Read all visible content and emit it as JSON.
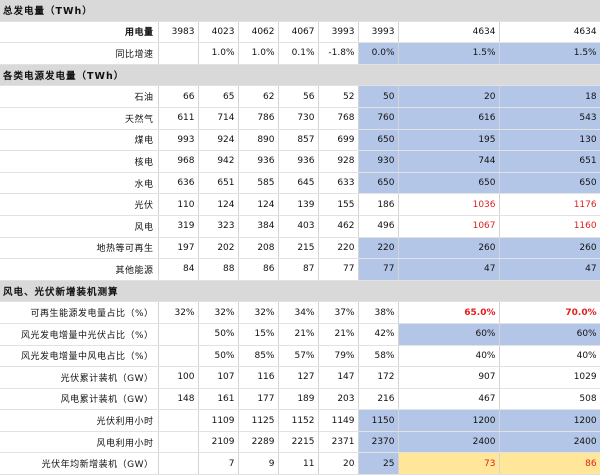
{
  "colors": {
    "blue": "#b4c6e7",
    "yellow": "#ffe699",
    "red": "#e02020",
    "section": "#d9d9d9"
  },
  "rows": [
    {
      "type": "section",
      "label": "总发电量（TWh）"
    },
    {
      "label": "用电量",
      "bold": true,
      "values": [
        "3983",
        "4023",
        "4062",
        "4067",
        "3993",
        "3993",
        "4634",
        "4634"
      ],
      "styles": [
        "",
        "",
        "",
        "",
        "",
        "",
        "",
        ""
      ]
    },
    {
      "label": "同比增速",
      "values": [
        "",
        "1.0%",
        "1.0%",
        "0.1%",
        "-1.8%",
        "0.0%",
        "1.5%",
        "1.5%"
      ],
      "styles": [
        "",
        "",
        "",
        "",
        "",
        "blue",
        "blue",
        "blue"
      ]
    },
    {
      "type": "section",
      "label": "各类电源发电量（TWh）"
    },
    {
      "label": "石油",
      "values": [
        "66",
        "65",
        "62",
        "56",
        "52",
        "50",
        "20",
        "18"
      ],
      "styles": [
        "",
        "",
        "",
        "",
        "",
        "blue",
        "blue",
        "blue"
      ]
    },
    {
      "label": "天然气",
      "values": [
        "611",
        "714",
        "786",
        "730",
        "768",
        "760",
        "616",
        "543"
      ],
      "styles": [
        "",
        "",
        "",
        "",
        "",
        "blue",
        "blue",
        "blue"
      ]
    },
    {
      "label": "煤电",
      "values": [
        "993",
        "924",
        "890",
        "857",
        "699",
        "650",
        "195",
        "130"
      ],
      "styles": [
        "",
        "",
        "",
        "",
        "",
        "blue",
        "blue",
        "blue"
      ]
    },
    {
      "label": "核电",
      "values": [
        "968",
        "942",
        "936",
        "936",
        "928",
        "930",
        "744",
        "651"
      ],
      "styles": [
        "",
        "",
        "",
        "",
        "",
        "blue",
        "blue",
        "blue"
      ]
    },
    {
      "label": "水电",
      "values": [
        "636",
        "651",
        "585",
        "645",
        "633",
        "650",
        "650",
        "650"
      ],
      "styles": [
        "",
        "",
        "",
        "",
        "",
        "blue",
        "blue",
        "blue"
      ]
    },
    {
      "label": "光伏",
      "values": [
        "110",
        "124",
        "124",
        "139",
        "155",
        "186",
        "1036",
        "1176"
      ],
      "styles": [
        "",
        "",
        "",
        "",
        "",
        "",
        "red",
        "red"
      ]
    },
    {
      "label": "风电",
      "values": [
        "319",
        "323",
        "384",
        "403",
        "462",
        "496",
        "1067",
        "1160"
      ],
      "styles": [
        "",
        "",
        "",
        "",
        "",
        "",
        "red",
        "red"
      ]
    },
    {
      "label": "地热等可再生",
      "values": [
        "197",
        "202",
        "208",
        "215",
        "220",
        "220",
        "260",
        "260"
      ],
      "styles": [
        "",
        "",
        "",
        "",
        "",
        "blue",
        "blue",
        "blue"
      ]
    },
    {
      "label": "其他能源",
      "values": [
        "84",
        "88",
        "86",
        "87",
        "77",
        "77",
        "47",
        "47"
      ],
      "styles": [
        "",
        "",
        "",
        "",
        "",
        "blue",
        "blue",
        "blue"
      ]
    },
    {
      "type": "section",
      "label": "风电、光伏新增装机测算"
    },
    {
      "label": "可再生能源发电量占比（%）",
      "values": [
        "32%",
        "32%",
        "32%",
        "34%",
        "37%",
        "38%",
        "65.0%",
        "70.0%"
      ],
      "styles": [
        "",
        "",
        "",
        "",
        "",
        "",
        "red bold",
        "red bold"
      ]
    },
    {
      "label": "风光发电增量中光伏占比（%）",
      "values": [
        "",
        "50%",
        "15%",
        "21%",
        "21%",
        "42%",
        "60%",
        "60%"
      ],
      "styles": [
        "",
        "",
        "",
        "",
        "",
        "",
        "blue",
        "blue"
      ]
    },
    {
      "label": "风光发电增量中风电占比（%）",
      "values": [
        "",
        "50%",
        "85%",
        "57%",
        "79%",
        "58%",
        "40%",
        "40%"
      ],
      "styles": [
        "",
        "",
        "",
        "",
        "",
        "",
        "",
        ""
      ]
    },
    {
      "label": "光伏累计装机（GW）",
      "values": [
        "100",
        "107",
        "116",
        "127",
        "147",
        "172",
        "907",
        "1029"
      ],
      "styles": [
        "",
        "",
        "",
        "",
        "",
        "",
        "",
        ""
      ]
    },
    {
      "label": "风电累计装机（GW）",
      "values": [
        "148",
        "161",
        "177",
        "189",
        "203",
        "216",
        "467",
        "508"
      ],
      "styles": [
        "",
        "",
        "",
        "",
        "",
        "",
        "",
        ""
      ]
    },
    {
      "label": "光伏利用小时",
      "values": [
        "",
        "1109",
        "1125",
        "1152",
        "1149",
        "1150",
        "1200",
        "1200"
      ],
      "styles": [
        "",
        "",
        "",
        "",
        "",
        "blue",
        "blue",
        "blue"
      ]
    },
    {
      "label": "风电利用小时",
      "values": [
        "",
        "2109",
        "2289",
        "2215",
        "2371",
        "2370",
        "2400",
        "2400"
      ],
      "styles": [
        "",
        "",
        "",
        "",
        "",
        "blue",
        "blue",
        "blue"
      ]
    },
    {
      "label": "光伏年均新增装机（GW）",
      "values": [
        "",
        "7",
        "9",
        "11",
        "20",
        "25",
        "73",
        "86"
      ],
      "styles": [
        "",
        "",
        "",
        "",
        "",
        "blue",
        "yellow red",
        "yellow red"
      ]
    }
  ]
}
